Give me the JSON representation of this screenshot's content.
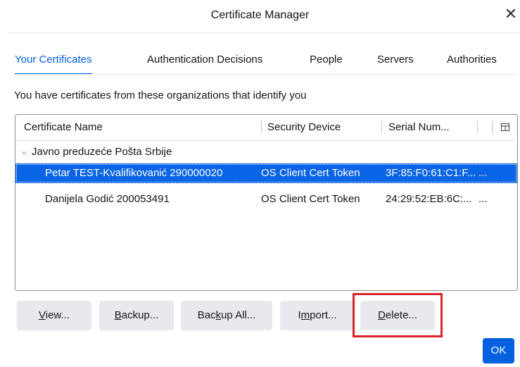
{
  "window": {
    "title": "Certificate Manager",
    "close_symbol": "✕"
  },
  "tabs": [
    {
      "label": "Your Certificates",
      "active": true
    },
    {
      "label": "Authentication Decisions",
      "active": false
    },
    {
      "label": "People",
      "active": false
    },
    {
      "label": "Servers",
      "active": false
    },
    {
      "label": "Authorities",
      "active": false
    }
  ],
  "description": "You have certificates from these organizations that identify you",
  "table": {
    "columns": [
      "Certificate Name",
      "Security Device",
      "Serial Num..."
    ],
    "group": {
      "expander": "⌵",
      "name": "Javno preduzeće Pošta Srbije"
    },
    "rows": [
      {
        "name": "Petar TEST-Kvalifikovanić 290000020",
        "device": "OS Client Cert Token",
        "serial": "3F:85:F0:61:C1:F...",
        "extra": "...",
        "selected": true
      },
      {
        "name": "Danijela Godić 200053491",
        "device": "OS Client Cert Token",
        "serial": "24:29:52:EB:6C:...",
        "extra": "...",
        "selected": false
      }
    ]
  },
  "buttons": {
    "view": {
      "accesskey": "V",
      "rest": "iew..."
    },
    "backup": {
      "accesskey": "B",
      "rest": "ackup..."
    },
    "backup_all": {
      "pre": "Bac",
      "accesskey": "k",
      "rest": "up All..."
    },
    "import": {
      "pre": "I",
      "accesskey": "m",
      "rest": "port..."
    },
    "delete": {
      "accesskey": "D",
      "rest": "elete..."
    },
    "ok": "OK"
  },
  "colors": {
    "accent": "#0061e0",
    "selection": "#0a64e6",
    "highlight_box": "#d9232a"
  }
}
